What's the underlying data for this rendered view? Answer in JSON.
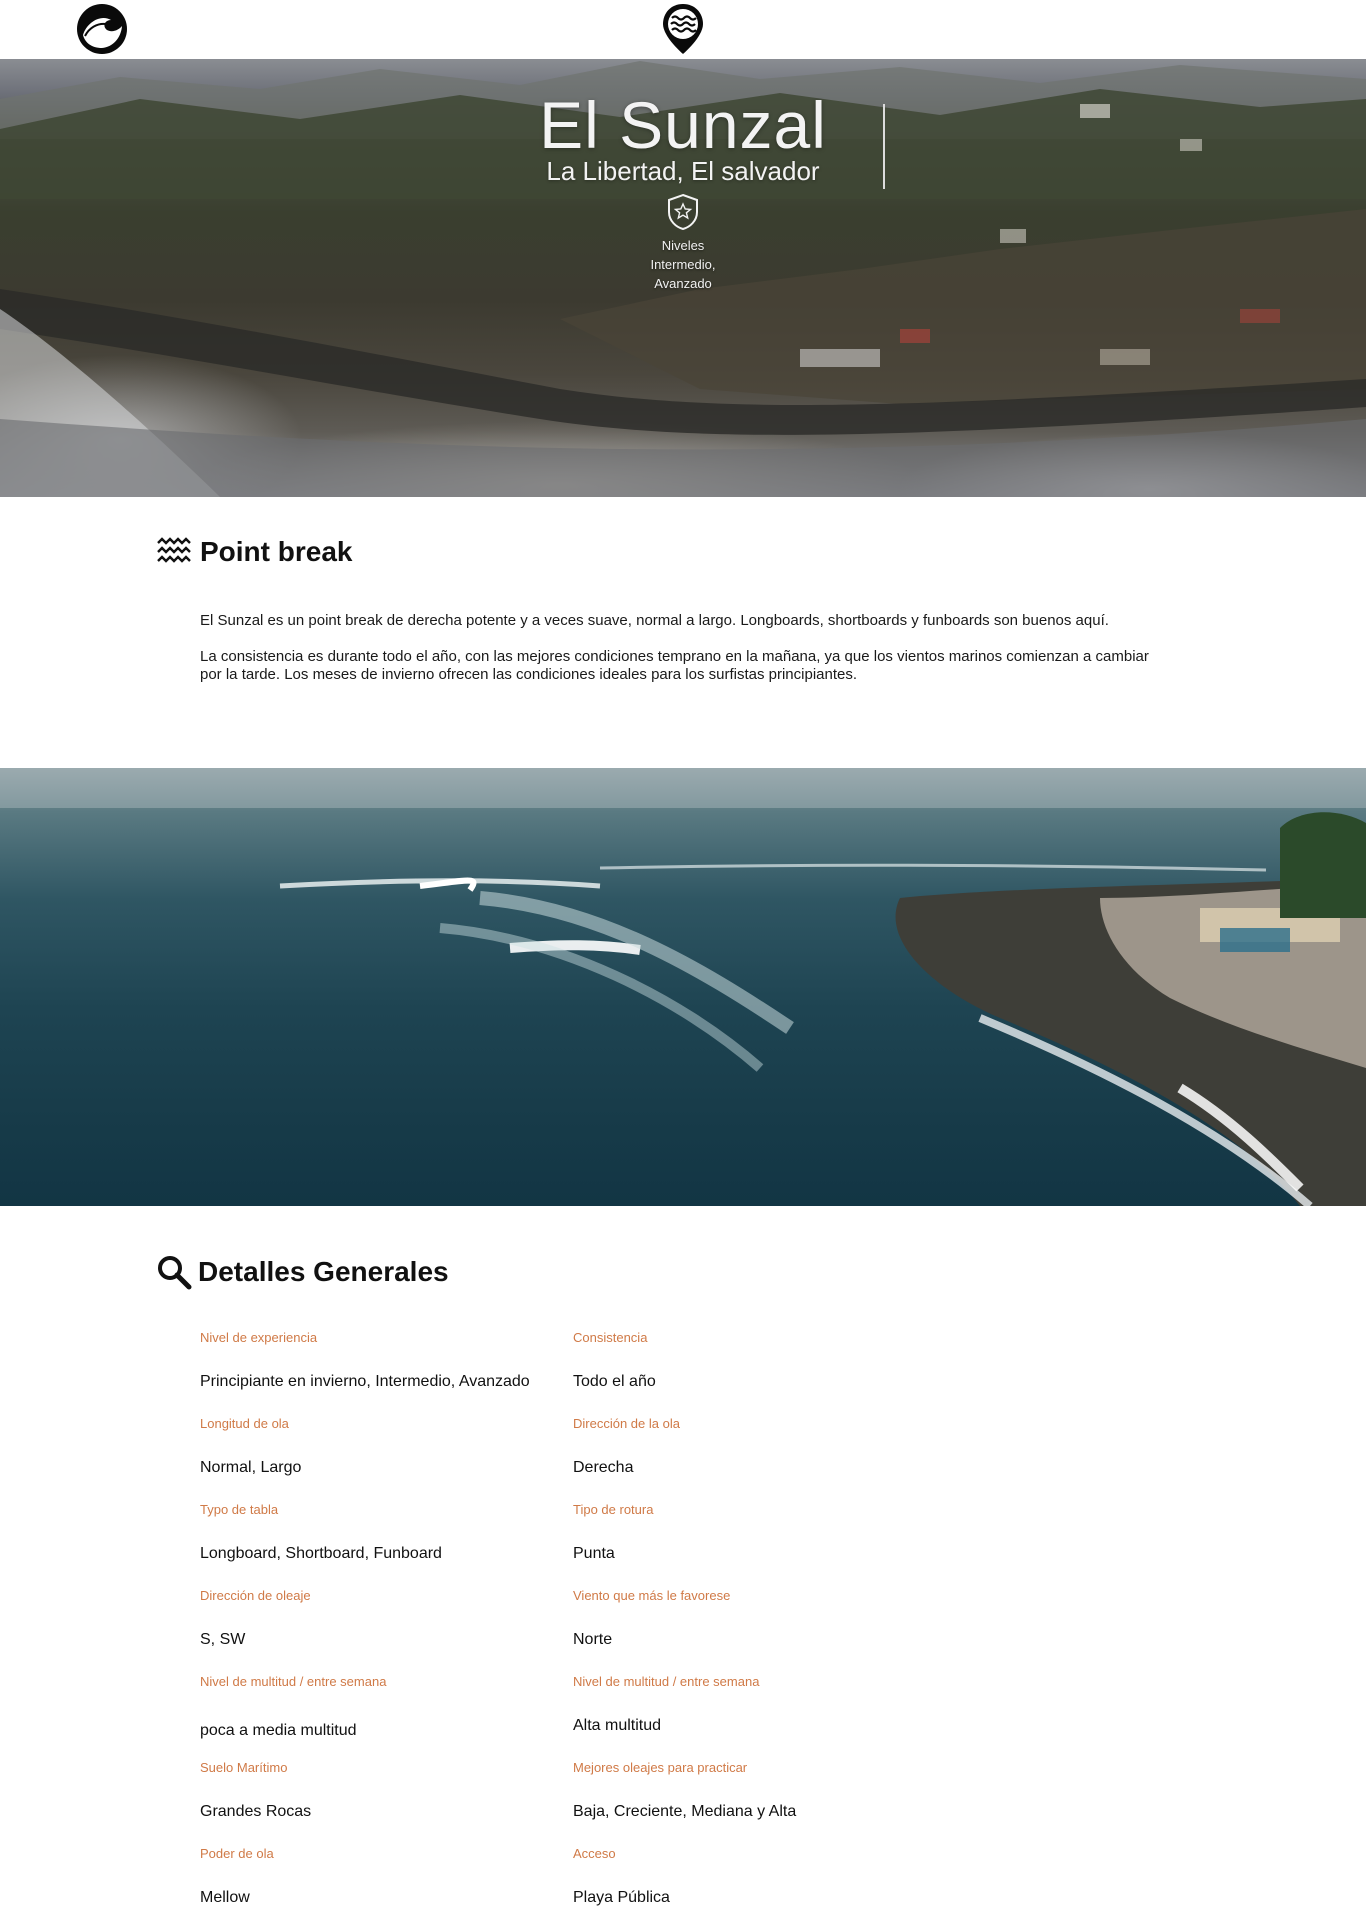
{
  "hero": {
    "title": "El Sunzal",
    "subtitle": "La Libertad, El salvador",
    "levels_label": "Niveles",
    "levels_line1": "Intermedio,",
    "levels_line2": "Avanzado"
  },
  "intro": {
    "heading": "Point break",
    "paragraph1": "El Sunzal es un point break de derecha potente y a veces suave, normal a largo. Longboards, shortboards y funboards son buenos aquí.",
    "paragraph2": "La consistencia es durante todo el año, con las mejores condiciones temprano en la mañana, ya que los vientos marinos comienzan a cambiar\npor la tarde. Los meses de invierno ofrecen las condiciones ideales para los surfistas principiantes."
  },
  "details": {
    "heading": "Detalles Generales",
    "rows": [
      {
        "left": {
          "label": "Nivel de experiencia",
          "value": "Principiante en invierno, Intermedio, Avanzado"
        },
        "right": {
          "label": "Consistencia",
          "value": "Todo el año"
        }
      },
      {
        "left": {
          "label": "Longitud de ola",
          "value": "Normal, Largo"
        },
        "right": {
          "label": "Dirección de la ola",
          "value": "Derecha"
        }
      },
      {
        "left": {
          "label": "Typo de tabla",
          "value": "Longboard, Shortboard, Funboard"
        },
        "right": {
          "label": "Tipo de rotura",
          "value": "Punta"
        }
      },
      {
        "left": {
          "label": "Dirección de oleaje",
          "value": "S, SW"
        },
        "right": {
          "label": "Viento que más le favorese",
          "value": "Norte"
        }
      },
      {
        "left": {
          "label": "Nivel de multitud / entre semana",
          "value": "poca a media multitud"
        },
        "right": {
          "label": "Nivel de multitud / entre semana",
          "value": "Alta multitud"
        }
      },
      {
        "left": {
          "label": "Suelo Marítimo",
          "value": "Grandes Rocas"
        },
        "right": {
          "label": "Mejores oleajes para practicar",
          "value": "Baja, Creciente, Mediana y Alta"
        }
      },
      {
        "left": {
          "label": "Poder de ola",
          "value": "Mellow"
        },
        "right": {
          "label": "Acceso",
          "value": "Playa Pública"
        }
      }
    ]
  },
  "icons": {
    "logo": "wave-logo-icon",
    "location": "location-pin-waves-icon",
    "level_badge": "star-shield-icon",
    "section_waves": "waves-icon",
    "section_search": "search-icon"
  },
  "colors": {
    "label_accent": "#d07a47",
    "text": "#111111"
  }
}
